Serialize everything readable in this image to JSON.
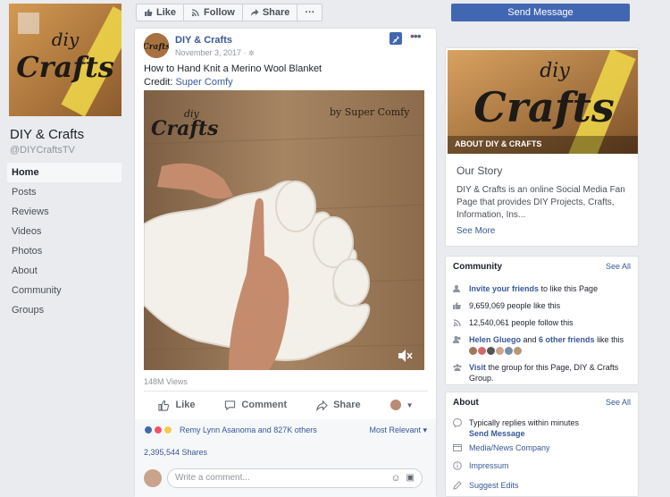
{
  "page": {
    "logo_text_top": "diy",
    "logo_text_main": "Crafts",
    "name": "DIY & Crafts",
    "handle": "@DIYCraftsTV"
  },
  "nav": [
    "Home",
    "Posts",
    "Reviews",
    "Videos",
    "Photos",
    "About",
    "Community",
    "Groups"
  ],
  "actionbar": {
    "like": "Like",
    "follow": "Follow",
    "share": "Share",
    "more": "···"
  },
  "post": {
    "author": "DIY & Crafts",
    "date": "November 3, 2017 · ",
    "title": "How to Hand Knit a Merino Wool Blanket",
    "credit_label": "Credit: ",
    "credit_name": "Super Comfy",
    "video_watermark": "by Super Comfy",
    "views": "148M Views",
    "actions": {
      "like": "Like",
      "comment": "Comment",
      "share": "Share"
    },
    "reactions_text": "Remy Lynn Asanoma and 827K others",
    "most_relevant": "Most Relevant ▾",
    "shares": "2,395,544 Shares",
    "comment_placeholder": "Write a comment..."
  },
  "right": {
    "send_message": "Send Message",
    "about_label": "ABOUT DIY & CRAFTS",
    "story_heading": "Our Story",
    "story_text": "DIY & Crafts is an online Social Media Fan Page that provides DIY Projects, Crafts, Information, Ins...",
    "see_more": "See More",
    "community": {
      "heading": "Community",
      "see_all": "See All",
      "invite_link": "Invite your friends",
      "invite_rest": " to like this Page",
      "likes": "9,659,069 people like this",
      "follows": "12,540,061 people follow this",
      "friends_link1": "Helen Gluego",
      "friends_and": " and ",
      "friends_link2": "6 other friends",
      "friends_rest": " like this",
      "group_link": "Visit",
      "group_rest": " the group for this Page, DIY & Crafts Group."
    },
    "about": {
      "heading": "About",
      "see_all": "See All",
      "replies": "Typically replies within minutes",
      "send_message": "Send Message",
      "category": "Media/News Company",
      "impressum": "Impressum",
      "suggest": "Suggest Edits"
    }
  },
  "colors": {
    "brand_blue": "#4267b2",
    "link": "#385898",
    "bg": "#e9ebee"
  }
}
